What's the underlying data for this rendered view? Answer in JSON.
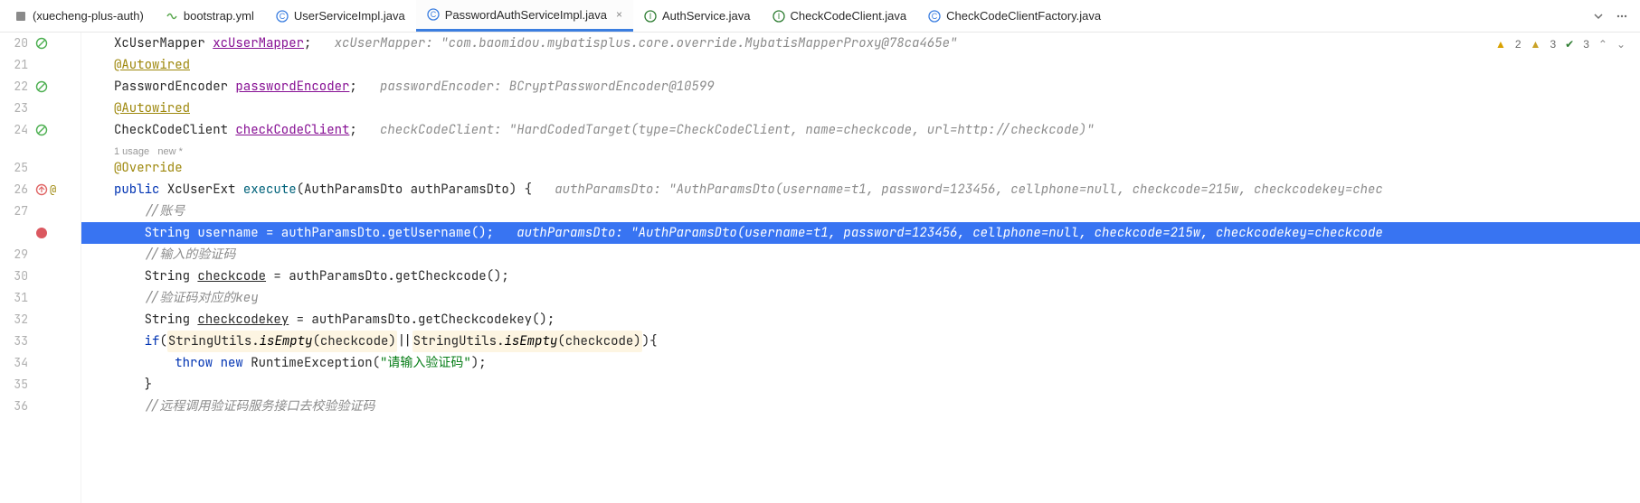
{
  "tabs": [
    {
      "label": "(xuecheng-plus-auth)",
      "icon": "project"
    },
    {
      "label": "bootstrap.yml",
      "icon": "yaml"
    },
    {
      "label": "UserServiceImpl.java",
      "icon": "class"
    },
    {
      "label": "PasswordAuthServiceImpl.java",
      "icon": "class",
      "active": true,
      "closeable": true
    },
    {
      "label": "AuthService.java",
      "icon": "interface"
    },
    {
      "label": "CheckCodeClient.java",
      "icon": "interface"
    },
    {
      "label": "CheckCodeClientFactory.java",
      "icon": "class"
    }
  ],
  "badges": {
    "warn_a": "2",
    "warn_b": "3",
    "ok": "3"
  },
  "lens": {
    "usages": "1 usage",
    "author": "new *"
  },
  "code": {
    "l20": {
      "indent": "",
      "type": "XcUserMapper ",
      "field": "xcUserMapper",
      "semi": ";",
      "hint": "   xcUserMapper: \"com.baomidou.mybatisplus.core.override.MybatisMapperProxy@78ca465e\""
    },
    "l21": {
      "indent": "",
      "ann": "@Autowired"
    },
    "l22": {
      "indent": "",
      "type": "PasswordEncoder ",
      "field": "passwordEncoder",
      "semi": ";",
      "hint": "   passwordEncoder: BCryptPasswordEncoder@10599"
    },
    "l23": {
      "indent": "",
      "ann": "@Autowired"
    },
    "l24": {
      "indent": "",
      "type": "CheckCodeClient ",
      "field": "checkCodeClient",
      "semi": ";",
      "hint": "   checkCodeClient: \"HardCodedTarget(type=CheckCodeClient, name=checkcode, url=http://checkcode)\""
    },
    "l25": {
      "indent": "",
      "ann": "@Override"
    },
    "l26": {
      "indent": "",
      "kw": "public ",
      "ret": "XcUserExt ",
      "name": "execute",
      "params": "(AuthParamsDto authParamsDto) {",
      "hint": "   authParamsDto: \"AuthParamsDto(username=t1, password=123456, cellphone=null, checkcode=215w, checkcodekey=chec"
    },
    "l27": {
      "indent": "    ",
      "cmt": "//账号"
    },
    "l28": {
      "indent": "    ",
      "code": "String username = authParamsDto.getUsername();",
      "hint": "   authParamsDto: \"AuthParamsDto(username=t1, password=123456, cellphone=null, checkcode=215w, checkcodekey=checkcode"
    },
    "l29": {
      "indent": "    ",
      "cmt": "//输入的验证码"
    },
    "l30": {
      "indent": "    ",
      "t1": "String ",
      "v1": "checkcode",
      "t2": " = authParamsDto.getCheckcode();"
    },
    "l31": {
      "indent": "    ",
      "cmt": "//验证码对应的key"
    },
    "l32": {
      "indent": "    ",
      "t1": "String ",
      "v1": "checkcodekey",
      "t2": " = authParamsDto.getCheckcodekey();"
    },
    "l33": {
      "indent": "    ",
      "kw": "if",
      "open": "(",
      "cls": "StringUtils",
      "dot1": ".",
      "m1": "isEmpty",
      "a1": "(checkcode)",
      "or": "||",
      "cls2": "StringUtils",
      "dot2": ".",
      "m2": "isEmpty",
      "a2": "(checkcode)",
      "close": "){"
    },
    "l34": {
      "indent": "        ",
      "kw1": "throw ",
      "kw2": "new ",
      "ex": "RuntimeException(",
      "str": "\"请输入验证码\"",
      "end": ");"
    },
    "l35": {
      "indent": "    ",
      "txt": "}"
    },
    "l36": {
      "indent": "    ",
      "cmt": "//远程调用验证码服务接口去校验验证码"
    }
  }
}
